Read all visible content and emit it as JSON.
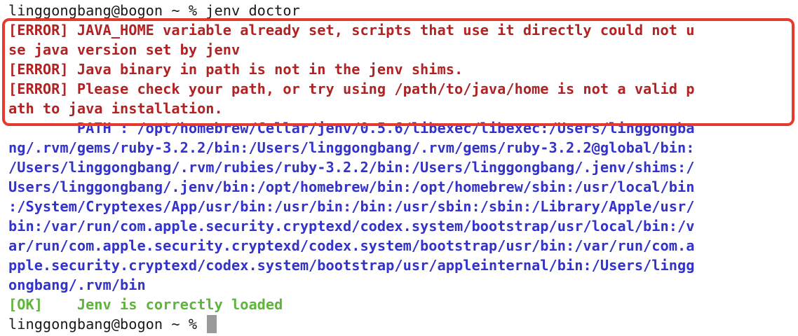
{
  "terminal": {
    "command_line": "linggongbang@bogon ~ % jenv doctor",
    "error_lines": [
      "[ERROR] JAVA_HOME variable already set, scripts that use it directly could not u",
      "se java version set by jenv",
      "[ERROR] Java binary in path is not in the jenv shims.",
      "[ERROR] Please check your path, or try using /path/to/java/home is not a valid p",
      "ath to java installation."
    ],
    "path_lines": [
      "        PATH : /opt/homebrew/Cellar/jenv/0.5.6/libexec/libexec:/Users/linggongba",
      "ng/.rvm/gems/ruby-3.2.2/bin:/Users/linggongbang/.rvm/gems/ruby-3.2.2@global/bin:",
      "/Users/linggongbang/.rvm/rubies/ruby-3.2.2/bin:/Users/linggongbang/.jenv/shims:/",
      "Users/linggongbang/.jenv/bin:/opt/homebrew/bin:/opt/homebrew/sbin:/usr/local/bin",
      ":/System/Cryptexes/App/usr/bin:/usr/bin:/bin:/usr/sbin:/sbin:/Library/Apple/usr/",
      "bin:/var/run/com.apple.security.cryptexd/codex.system/bootstrap/usr/local/bin:/v",
      "ar/run/com.apple.security.cryptexd/codex.system/bootstrap/usr/bin:/var/run/com.a",
      "pple.security.cryptexd/codex.system/bootstrap/usr/appleinternal/bin:/Users/lingg",
      "ongbang/.rvm/bin"
    ],
    "ok_line": "[OK]    Jenv is correctly loaded",
    "prompt": "linggongbang@bogon ~ % "
  },
  "colors": {
    "error": "#b22222",
    "path": "#3333cc",
    "ok": "#5fb43c",
    "highlight_border": "#e53b2e",
    "cursor": "#9a9a9a"
  },
  "icons": {
    "cursor": "block-cursor"
  }
}
